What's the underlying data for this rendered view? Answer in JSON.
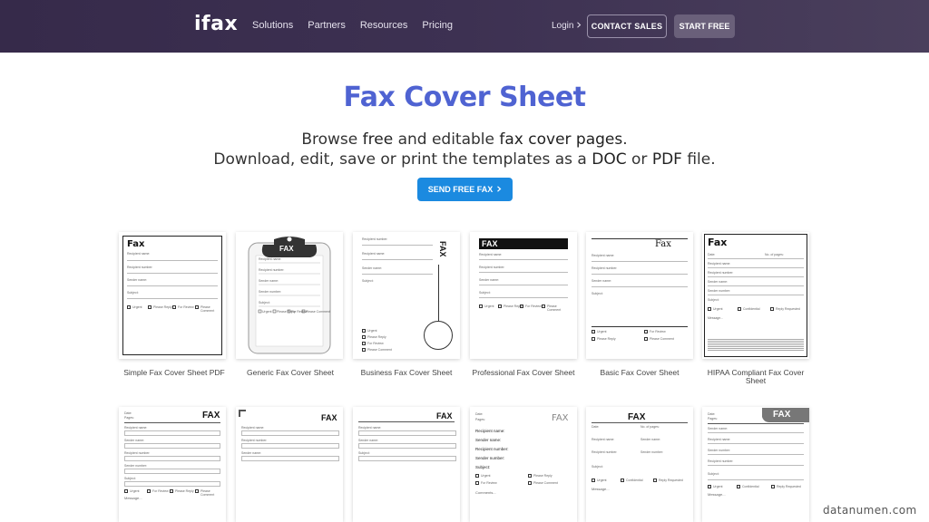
{
  "nav": {
    "logo": "ifax",
    "links": [
      "Solutions",
      "Partners",
      "Resources",
      "Pricing"
    ],
    "login": "Login",
    "contact_sales": "CONTACT SALES",
    "start_free": "START FREE"
  },
  "hero": {
    "title": "Fax Cover Sheet",
    "line1_pre": "Browse ",
    "line1_b1": "free",
    "line1_mid": " and editable ",
    "line1_b2": "fax cover pages",
    "line1_post": ".",
    "line2_pre": "Download, edit, save or print the templates as a ",
    "line2_b1": "DOC",
    "line2_mid": " or ",
    "line2_b2": "PDF",
    "line2_post": " file.",
    "send_button": "SEND FREE FAX"
  },
  "templates_row1": [
    {
      "label": "Simple Fax Cover Sheet PDF",
      "thumb_title": "Fax"
    },
    {
      "label": "Generic Fax Cover Sheet",
      "thumb_title": "FAX"
    },
    {
      "label": "Business Fax Cover Sheet",
      "thumb_title": "FAX"
    },
    {
      "label": "Professional Fax Cover Sheet",
      "thumb_title": "FAX"
    },
    {
      "label": "Basic Fax Cover Sheet",
      "thumb_title": "Fax"
    },
    {
      "label": "HIPAA Compliant Fax Cover Sheet",
      "thumb_title": "Fax"
    }
  ],
  "templates_row2": [
    {
      "thumb_title": "FAX"
    },
    {
      "thumb_title": "FAX"
    },
    {
      "thumb_title": "FAX"
    },
    {
      "thumb_title": "FAX"
    },
    {
      "thumb_title": "FAX"
    },
    {
      "thumb_title": "FAX"
    }
  ],
  "thumb_text": {
    "recipient_name": "Recipient name:",
    "sender_name": "Sender name:",
    "recipient_number": "Recipient number:",
    "sender_number": "Sender number:",
    "subject": "Subject:",
    "message": "Message...",
    "urgent": "Urgent",
    "please_reply": "Please Reply",
    "for_review": "For Review",
    "please_comment": "Please Comment",
    "confidential": "Confidential",
    "reply_requested": "Reply Requested",
    "date": "Date:",
    "pages": "Pages:",
    "no_of_pages": "No. of pages:",
    "comments": "Comments..."
  },
  "watermark": "datanumen.com",
  "colors": {
    "nav_bg": "#3d3152",
    "title_blue": "#4f63d2",
    "send_blue": "#1b8ae0"
  }
}
